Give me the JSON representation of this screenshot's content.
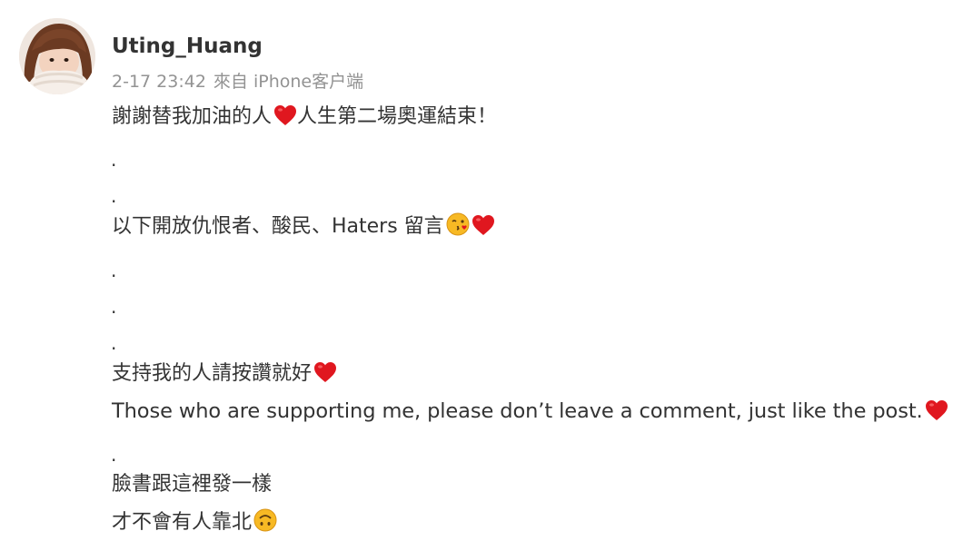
{
  "post": {
    "username": "Uting_Huang",
    "timestamp": "2-17 23:42",
    "source": "來自 iPhone客户端",
    "lines": [
      {
        "text": "謝謝替我加油的人",
        "emoji": [
          "heart"
        ],
        "tail": "人生第二場奧運結束！"
      },
      {
        "text": "."
      },
      {
        "text": "."
      },
      {
        "text": "以下開放仇恨者、酸民、Haters 留言",
        "emoji": [
          "kissing-face",
          "heart"
        ]
      },
      {
        "text": "."
      },
      {
        "text": "."
      },
      {
        "text": "."
      },
      {
        "text": "支持我的人請按讚就好",
        "emoji": [
          "heart"
        ]
      },
      {
        "text": "Those who are supporting me, please don’t leave a comment, just like the post.",
        "emoji": [
          "heart"
        ]
      },
      {
        "text": "."
      },
      {
        "text": "臉書跟這裡發一樣"
      },
      {
        "text": "才不會有人靠北",
        "emoji": [
          "upside-down-face"
        ]
      }
    ]
  },
  "colors": {
    "heart": "#e0171f",
    "emoji_face": "#f7b924",
    "meta_text": "#939393",
    "body_text": "#333333"
  }
}
